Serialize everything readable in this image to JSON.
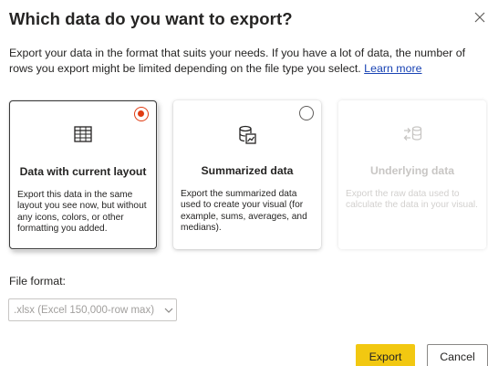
{
  "dialog": {
    "title": "Which data do you want to export?",
    "description": "Export your data in the format that suits your needs. If you have a lot of data, the number of rows you export might be limited depending on the file type you select.",
    "learn_more": "Learn more",
    "close_icon": "close-icon"
  },
  "options": [
    {
      "title": "Data with current layout",
      "description": "Export this data in the same layout you see now, but without any icons, colors, or other formatting you added.",
      "selected": true,
      "enabled": true,
      "icon": "table-icon"
    },
    {
      "title": "Summarized data",
      "description": "Export the summarized data used to create your visual (for example, sums, averages, and medians).",
      "selected": false,
      "enabled": true,
      "icon": "database-chart-icon"
    },
    {
      "title": "Underlying data",
      "description": "Export the raw data used to calculate the data in your visual.",
      "selected": false,
      "enabled": false,
      "icon": "database-arrows-icon"
    }
  ],
  "file_format": {
    "label": "File format:",
    "value": ".xlsx (Excel 150,000-row max)"
  },
  "buttons": {
    "export": "Export",
    "cancel": "Cancel"
  },
  "colors": {
    "accent_radio": "#e03c13",
    "primary_button": "#f2c811",
    "link": "#1a44b4"
  }
}
